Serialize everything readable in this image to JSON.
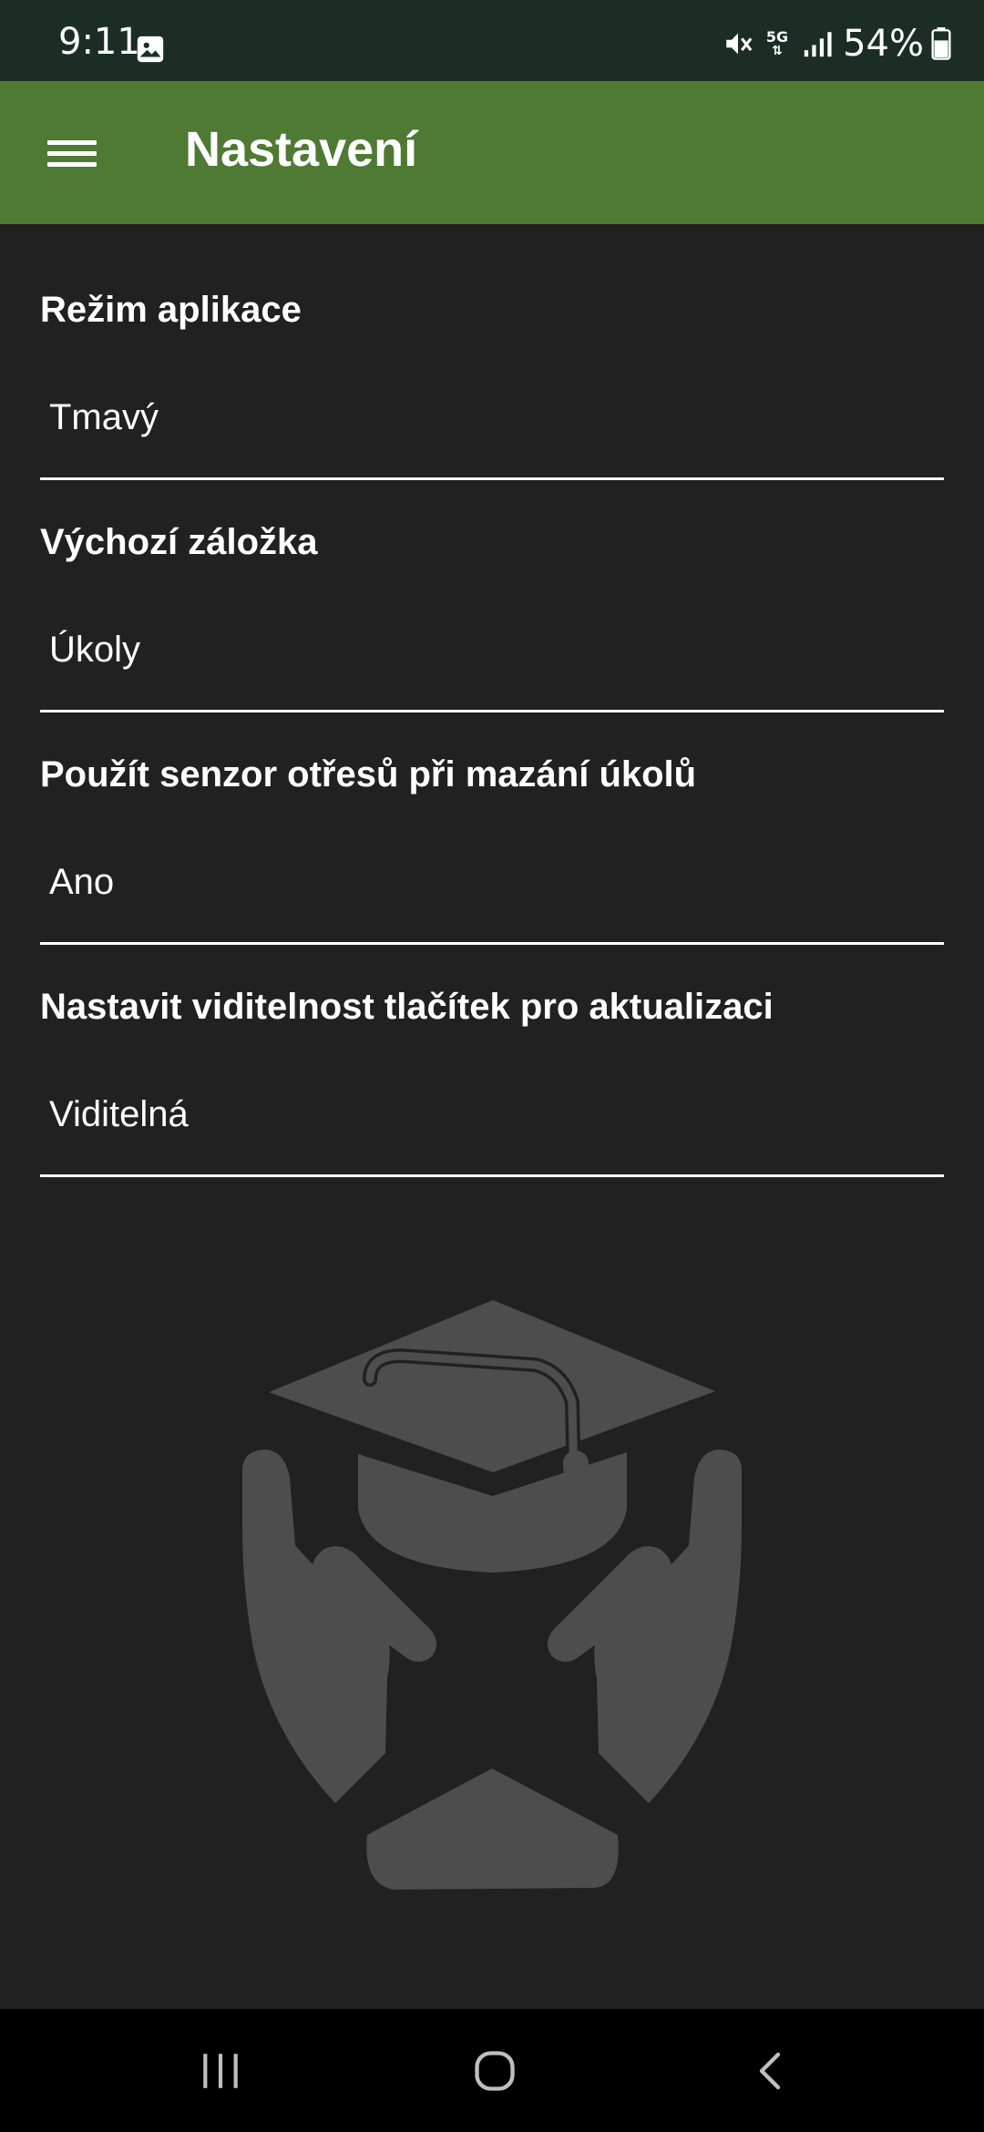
{
  "status_bar": {
    "time": "9:11",
    "battery": "54%",
    "network": "5G",
    "icons": [
      "gallery-icon",
      "mute-icon",
      "5g-icon",
      "signal-icon",
      "battery-icon"
    ]
  },
  "app_bar": {
    "title": "Nastavení",
    "menu_icon": "hamburger-menu-icon",
    "color": "#4e7a33"
  },
  "settings": [
    {
      "title": "Režim aplikace",
      "value": "Tmavý"
    },
    {
      "title": "Výchozí záložka",
      "value": "Úkoly"
    },
    {
      "title": "Použít senzor otřesů při mazání úkolů",
      "value": "Ano"
    },
    {
      "title": "Nastavit viditelnost tlačítek pro aktualizaci",
      "value": "Viditelná"
    }
  ],
  "illustration": "graduation-cap-hands-icon",
  "nav_bar": {
    "icons": [
      "recent-apps-icon",
      "home-icon",
      "back-icon"
    ]
  },
  "colors": {
    "background": "#212121",
    "status_bar": "#1c2e24",
    "accent": "#4e7a33",
    "illustration": "#4d4d4d"
  }
}
